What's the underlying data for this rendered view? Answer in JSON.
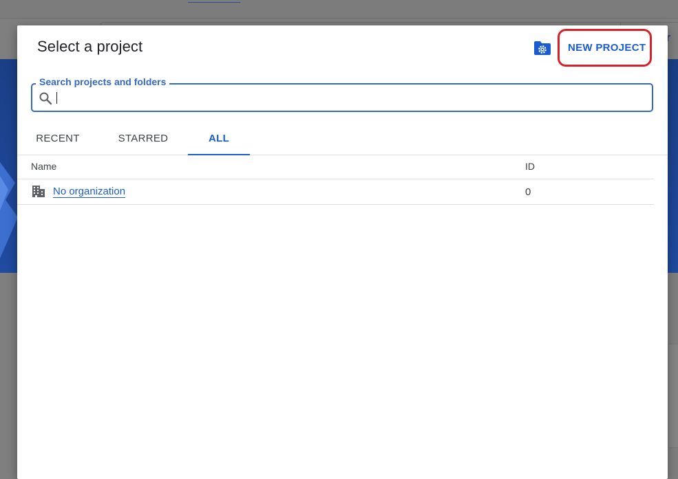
{
  "dialog": {
    "title": "Select a project",
    "new_project_label": "NEW PROJECT",
    "manage_icon": "folder-gear-icon",
    "search": {
      "label": "Search projects and folders",
      "value": "",
      "icon": "search-icon"
    },
    "tabs": [
      {
        "label": "RECENT",
        "active": false
      },
      {
        "label": "STARRED",
        "active": false
      },
      {
        "label": "ALL",
        "active": true
      }
    ],
    "table": {
      "columns": [
        "Name",
        "ID"
      ],
      "rows": [
        {
          "icon": "building-icon",
          "name": "No organization",
          "id": "0"
        }
      ]
    }
  },
  "colors": {
    "accent": "#1a5ccf",
    "highlight": "#d6202a",
    "text": "#202124"
  }
}
